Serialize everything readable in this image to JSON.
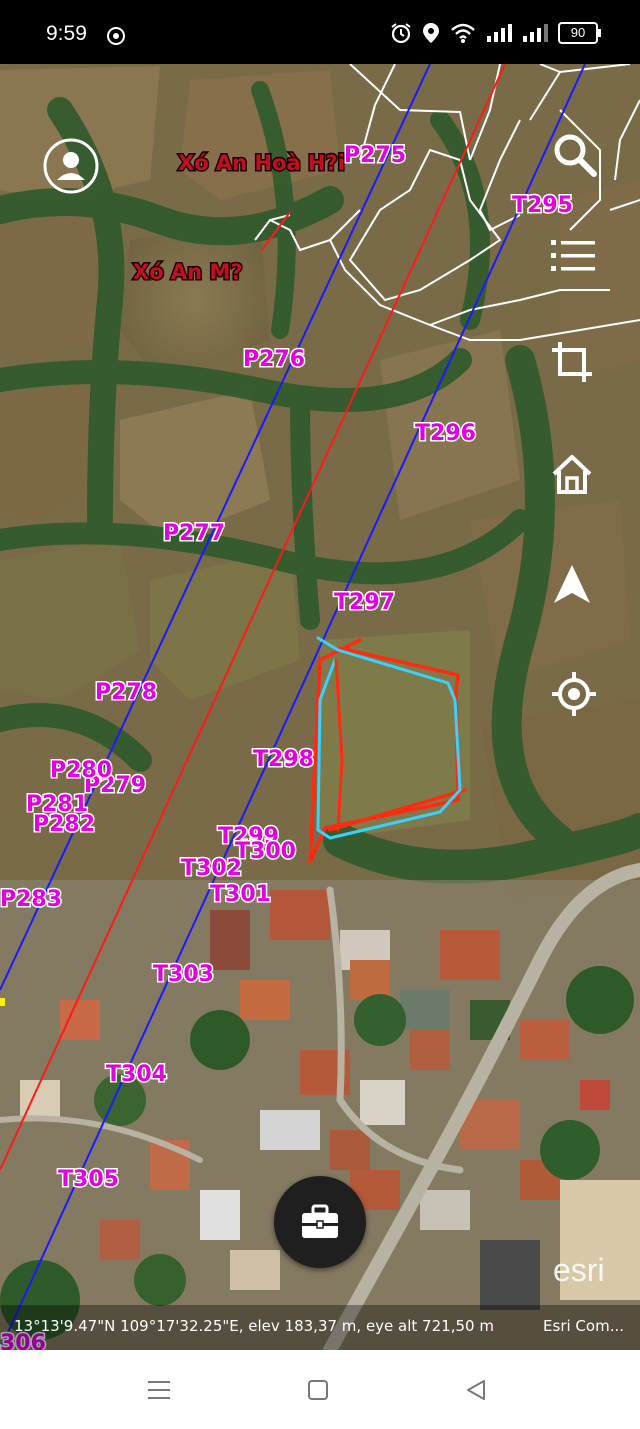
{
  "status_bar": {
    "time": "9:59",
    "battery": "90",
    "icons": [
      "chrome-icon",
      "alarm-icon",
      "location-icon",
      "wifi-icon",
      "signal-icon",
      "signal-icon-2",
      "battery-icon"
    ]
  },
  "map": {
    "base_layer": "satellite imagery",
    "place_labels": [
      "Xó An Hoà H?i",
      "Xó An M?"
    ],
    "power_line_p_labels": [
      "P275",
      "P276",
      "P277",
      "P278",
      "P279",
      "P280",
      "P281",
      "P282",
      "P283"
    ],
    "power_line_t_labels": [
      "T295",
      "T296",
      "T297",
      "T298",
      "T299",
      "T300",
      "T301",
      "T302",
      "T303",
      "T304",
      "T305",
      "306"
    ],
    "colors": {
      "line_blue": "#1a1aff",
      "line_red": "#ff1a1a",
      "pole_label": "#e000e0",
      "parcel_red": "#ff2a10",
      "parcel_cyan": "#3cd0ff",
      "boundaries": "#ffffff"
    },
    "buttons": {
      "profile": "user-circle-icon",
      "search": "search-icon",
      "layers": "list-icon",
      "crop": "crop-icon",
      "home": "home-icon",
      "navigate": "navigation-arrow-icon",
      "locate": "locate-crosshair-icon"
    }
  },
  "coords_bar": {
    "text": "13°13'9.47\"N 109°17'32.25\"E, elev 183,37 m, eye alt 721,50 m",
    "attribution": "Esri Com..."
  },
  "watermark": "esri",
  "tools_button": "briefcase-icon",
  "nav_bar": {
    "buttons": [
      "recent-apps-icon",
      "home-square-icon",
      "back-triangle-icon"
    ]
  }
}
